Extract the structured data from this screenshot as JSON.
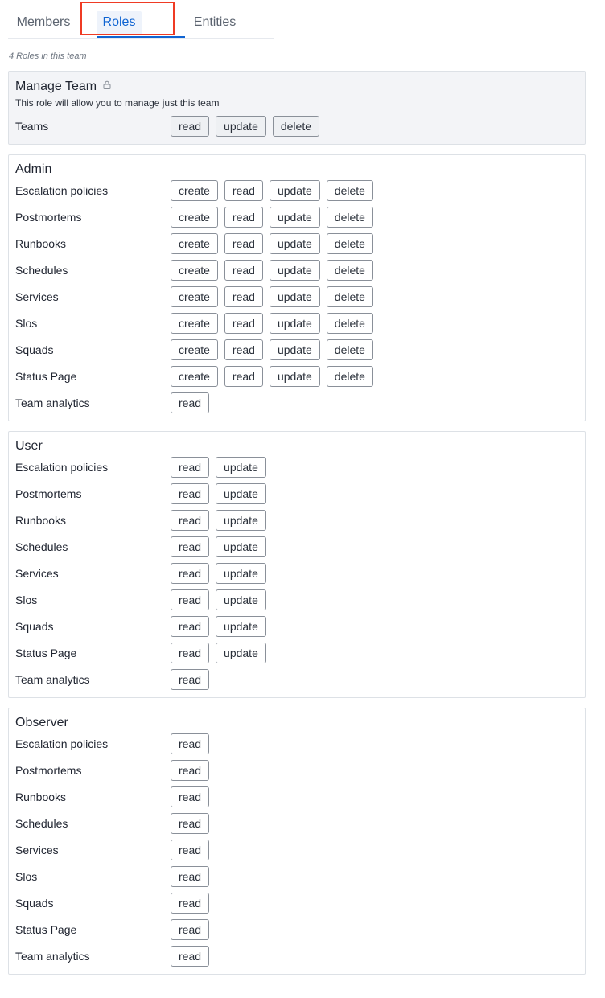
{
  "tabs": [
    {
      "label": "Members"
    },
    {
      "label": "Roles"
    },
    {
      "label": "Entities"
    }
  ],
  "subtitle": "4 Roles in this team",
  "roles": [
    {
      "name": "Manage Team",
      "locked": true,
      "icon": "lock-icon",
      "description": "This role will allow you to manage just this team",
      "permissions": [
        {
          "label": "Teams",
          "actions": [
            "read",
            "update",
            "delete"
          ]
        }
      ]
    },
    {
      "name": "Admin",
      "permissions": [
        {
          "label": "Escalation policies",
          "actions": [
            "create",
            "read",
            "update",
            "delete"
          ]
        },
        {
          "label": "Postmortems",
          "actions": [
            "create",
            "read",
            "update",
            "delete"
          ]
        },
        {
          "label": "Runbooks",
          "actions": [
            "create",
            "read",
            "update",
            "delete"
          ]
        },
        {
          "label": "Schedules",
          "actions": [
            "create",
            "read",
            "update",
            "delete"
          ]
        },
        {
          "label": "Services",
          "actions": [
            "create",
            "read",
            "update",
            "delete"
          ]
        },
        {
          "label": "Slos",
          "actions": [
            "create",
            "read",
            "update",
            "delete"
          ]
        },
        {
          "label": "Squads",
          "actions": [
            "create",
            "read",
            "update",
            "delete"
          ]
        },
        {
          "label": "Status Page",
          "actions": [
            "create",
            "read",
            "update",
            "delete"
          ]
        },
        {
          "label": "Team analytics",
          "actions": [
            "read"
          ]
        }
      ]
    },
    {
      "name": "User",
      "permissions": [
        {
          "label": "Escalation policies",
          "actions": [
            "read",
            "update"
          ]
        },
        {
          "label": "Postmortems",
          "actions": [
            "read",
            "update"
          ]
        },
        {
          "label": "Runbooks",
          "actions": [
            "read",
            "update"
          ]
        },
        {
          "label": "Schedules",
          "actions": [
            "read",
            "update"
          ]
        },
        {
          "label": "Services",
          "actions": [
            "read",
            "update"
          ]
        },
        {
          "label": "Slos",
          "actions": [
            "read",
            "update"
          ]
        },
        {
          "label": "Squads",
          "actions": [
            "read",
            "update"
          ]
        },
        {
          "label": "Status Page",
          "actions": [
            "read",
            "update"
          ]
        },
        {
          "label": "Team analytics",
          "actions": [
            "read"
          ]
        }
      ]
    },
    {
      "name": "Observer",
      "permissions": [
        {
          "label": "Escalation policies",
          "actions": [
            "read"
          ]
        },
        {
          "label": "Postmortems",
          "actions": [
            "read"
          ]
        },
        {
          "label": "Runbooks",
          "actions": [
            "read"
          ]
        },
        {
          "label": "Schedules",
          "actions": [
            "read"
          ]
        },
        {
          "label": "Services",
          "actions": [
            "read"
          ]
        },
        {
          "label": "Slos",
          "actions": [
            "read"
          ]
        },
        {
          "label": "Squads",
          "actions": [
            "read"
          ]
        },
        {
          "label": "Status Page",
          "actions": [
            "read"
          ]
        },
        {
          "label": "Team analytics",
          "actions": [
            "read"
          ]
        }
      ]
    }
  ],
  "colors": {
    "accent": "#0f64d2",
    "highlight": "#ef3b24"
  }
}
